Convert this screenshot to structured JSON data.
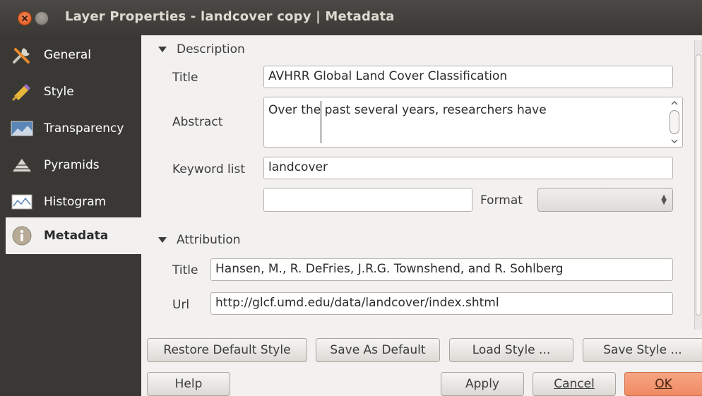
{
  "window": {
    "title": "Layer Properties - landcover copy | Metadata"
  },
  "sidebar": {
    "items": [
      {
        "label": "General",
        "icon": "wrench-icon"
      },
      {
        "label": "Style",
        "icon": "paintbrush-icon"
      },
      {
        "label": "Transparency",
        "icon": "transparency-icon"
      },
      {
        "label": "Pyramids",
        "icon": "pyramid-icon"
      },
      {
        "label": "Histogram",
        "icon": "histogram-icon"
      },
      {
        "label": "Metadata",
        "icon": "info-icon",
        "active": true
      }
    ]
  },
  "description": {
    "heading": "Description",
    "title_label": "Title",
    "title_value": "AVHRR Global Land Cover Classification",
    "abstract_label": "Abstract",
    "abstract_value": "Over the past several years, researchers have",
    "keyword_label": "Keyword list",
    "keyword_value": "landcover",
    "extra_value": "",
    "format_label": "Format",
    "format_value": ""
  },
  "attribution": {
    "heading": "Attribution",
    "title_label": "Title",
    "title_value": "Hansen, M., R. DeFries, J.R.G. Townshend, and R. Sohlberg",
    "url_label": "Url",
    "url_value": "http://glcf.umd.edu/data/landcover/index.shtml"
  },
  "buttons": {
    "restore_default_style": "Restore Default Style",
    "save_as_default": "Save As Default",
    "load_style": "Load Style ...",
    "save_style": "Save Style ...",
    "help": "Help",
    "apply": "Apply",
    "cancel": "Cancel",
    "ok": "OK"
  },
  "colors": {
    "sidebar_bg": "#393834",
    "titlebar_bg": "#3f3e3a",
    "ok_button": "#ef8a62",
    "close_button": "#e2561b"
  }
}
